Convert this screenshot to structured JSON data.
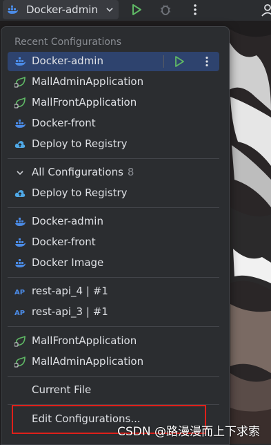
{
  "toolbar": {
    "run_config_label": "Docker-admin",
    "icons": [
      "docker-icon",
      "chevron-down-icon",
      "run-icon",
      "debug-icon",
      "more-vertical-icon",
      "user-icon"
    ]
  },
  "popup": {
    "recent_header": "Recent Configurations",
    "recent": [
      {
        "label": "Docker-admin",
        "icon": "docker-icon",
        "selected": true
      },
      {
        "label": "MallAdminApplication",
        "icon": "spring-boot-icon"
      },
      {
        "label": "MallFrontApplication",
        "icon": "spring-boot-icon"
      },
      {
        "label": "Docker-front",
        "icon": "docker-icon"
      },
      {
        "label": "Deploy to Registry",
        "icon": "cloud-upload-icon"
      }
    ],
    "all_configs": {
      "label": "All Configurations",
      "count": "8"
    },
    "groups": {
      "registry": [
        {
          "label": "Deploy to Registry",
          "icon": "cloud-upload-icon"
        }
      ],
      "docker": [
        {
          "label": "Docker-admin",
          "icon": "docker-icon"
        },
        {
          "label": "Docker-front",
          "icon": "docker-icon"
        },
        {
          "label": "Docker Image",
          "icon": "docker-icon"
        }
      ],
      "http": [
        {
          "label": "rest-api_4 | #1",
          "icon": "api-icon"
        },
        {
          "label": "rest-api_3 | #1",
          "icon": "api-icon"
        }
      ],
      "spring": [
        {
          "label": "MallFrontApplication",
          "icon": "spring-boot-icon"
        },
        {
          "label": "MallAdminApplication",
          "icon": "spring-boot-icon"
        }
      ]
    },
    "current_file": "Current File",
    "edit_configurations": "Edit Configurations..."
  },
  "watermark": "CSDN @路漫漫而上下求索",
  "colors": {
    "background": "#2b2d30",
    "selection": "#2e436e",
    "run_green": "#5fb865",
    "docker_blue": "#4b8be6",
    "highlight_red": "#e0201a"
  }
}
